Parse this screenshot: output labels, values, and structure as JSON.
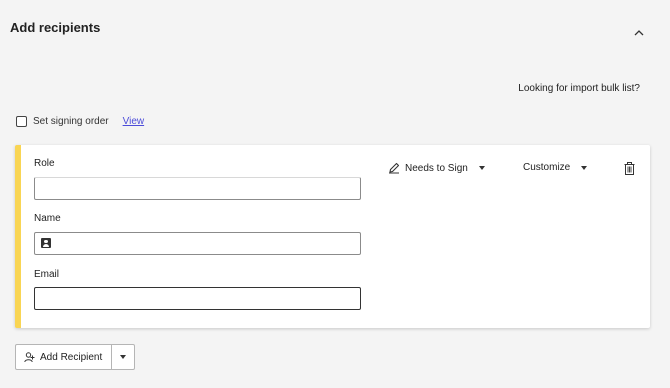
{
  "section": {
    "title": "Add recipients",
    "collapse_icon": "chevron-up-icon"
  },
  "import_link": "Looking for import bulk list?",
  "signing_order": {
    "label": "Set signing order",
    "checked": false,
    "view_link": "View"
  },
  "recipient": {
    "accent_color": "#f9d553",
    "fields": {
      "role": {
        "label": "Role",
        "value": ""
      },
      "name": {
        "label": "Name",
        "value": "",
        "icon": "contact-card-icon"
      },
      "email": {
        "label": "Email",
        "value": ""
      }
    },
    "action": {
      "label": "Needs to Sign",
      "icon": "pen-icon"
    },
    "customize": {
      "label": "Customize"
    },
    "delete_icon": "trash-icon"
  },
  "add_button": {
    "label": "Add Recipient",
    "icon": "person-add-icon"
  }
}
